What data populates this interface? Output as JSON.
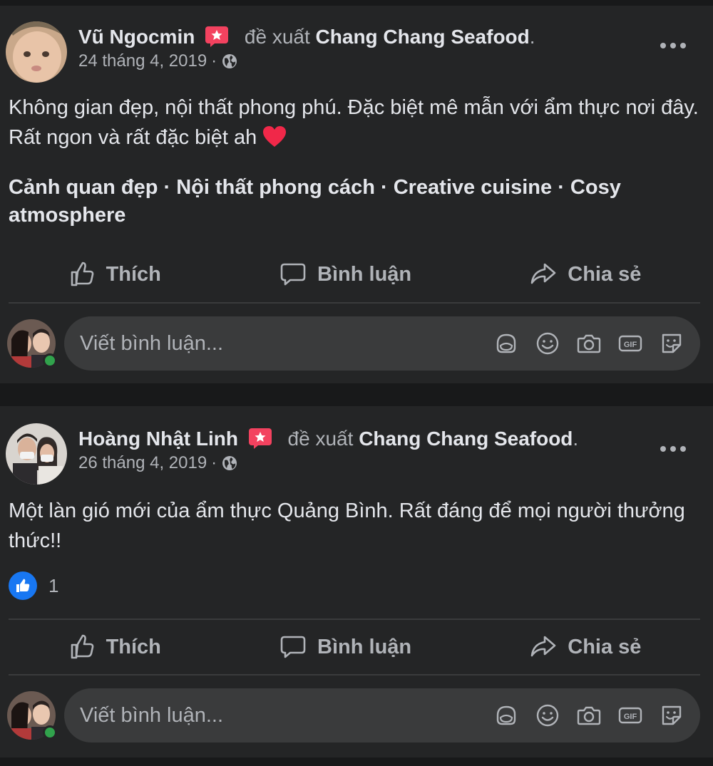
{
  "posts": [
    {
      "author": "Vũ Ngocmin",
      "verb": "đề xuất",
      "page": "Chang Chang Seafood",
      "date": "24 tháng 4, 2019",
      "text": "Không gian đẹp, nội thất phong phú. Đặc biệt mê mẫn với ẩm thực nơi đây. Rất ngon và rất đặc biệt ah",
      "tags": "Cảnh quan đẹp · Nội thất phong cách · Creative cuisine · Cosy atmosphere"
    },
    {
      "author": "Hoàng Nhật Linh",
      "verb": "đề xuất",
      "page": "Chang Chang Seafood",
      "date": "26 tháng 4, 2019",
      "text": "Một làn gió mới của ẩm thực Quảng Bình. Rất đáng để mọi người thưởng thức!!",
      "reaction_count": "1"
    }
  ],
  "actions": {
    "like": "Thích",
    "comment": "Bình luận",
    "share": "Chia sẻ"
  },
  "comment_placeholder": "Viết bình luận...",
  "icons": [
    "recommend-icon",
    "globe-icon",
    "heart-icon",
    "like-icon",
    "comment-icon",
    "share-icon",
    "avatar-sticker-icon",
    "emoji-icon",
    "camera-icon",
    "gif-icon",
    "sticker-icon",
    "more-icon"
  ],
  "colors": {
    "background": "#18191a",
    "card": "#242526",
    "input": "#3a3b3c",
    "secondary_text": "#b0b3b8",
    "accent": "#1877f2",
    "recommend": "#f3425f",
    "online": "#31a24c"
  }
}
